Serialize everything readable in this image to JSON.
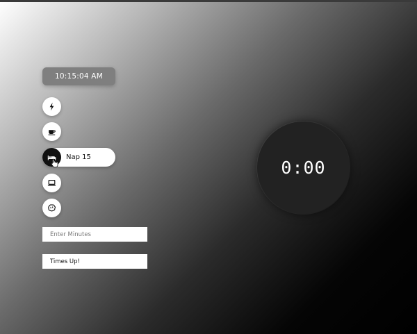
{
  "clock": {
    "time": "10:15:04 AM"
  },
  "modes": [
    {
      "id": "energy",
      "icon": "lightning-icon",
      "label": ""
    },
    {
      "id": "coffee",
      "icon": "coffee-cup-icon",
      "label": ""
    },
    {
      "id": "nap",
      "icon": "bed-icon",
      "label": "Nap 15",
      "active": true
    },
    {
      "id": "work",
      "icon": "laptop-icon",
      "label": ""
    },
    {
      "id": "brain",
      "icon": "brain-icon",
      "label": ""
    }
  ],
  "inputs": {
    "minutes_placeholder": "Enter Minutes",
    "minutes_value": "",
    "message_value": "Times Up!"
  },
  "timer": {
    "display": "0:00"
  },
  "colors": {
    "accent_dark": "#111111",
    "pill_grey": "#7f7f7f",
    "timer_bg": "#222222"
  }
}
